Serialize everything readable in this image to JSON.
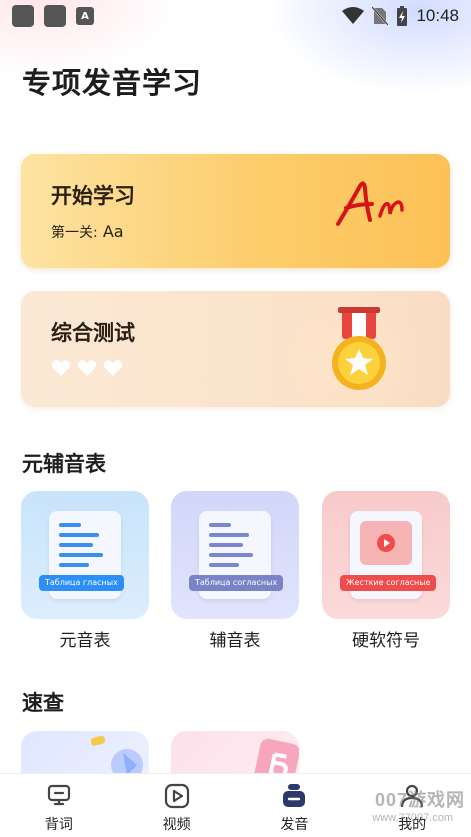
{
  "status_bar": {
    "time": "10:48",
    "notification_letter": "A"
  },
  "page": {
    "title": "专项发音学习"
  },
  "start_card": {
    "title": "开始学习",
    "level_prefix": "第一关:",
    "level_value": "Aa",
    "accent_color": "#fcc156"
  },
  "test_card": {
    "title": "综合测试",
    "hearts": 3
  },
  "phonetics_section": {
    "title": "元辅音表",
    "tiles": [
      {
        "label": "元音表",
        "badge": "Таблица гласных",
        "badge_color": "#2b8ff5"
      },
      {
        "label": "辅音表",
        "badge": "Таблица согласных",
        "badge_color": "#7b83c8"
      },
      {
        "label": "硬软符号",
        "badge": "Жесткие согласные",
        "badge_color": "#ef4c4c"
      }
    ]
  },
  "quick_section": {
    "title": "速查"
  },
  "tabbar": {
    "tabs": [
      {
        "label": "背词",
        "icon": "flashcard-icon",
        "active": false
      },
      {
        "label": "视频",
        "icon": "play-icon",
        "active": false
      },
      {
        "label": "发音",
        "icon": "pronunciation-icon",
        "active": true
      },
      {
        "label": "我的",
        "icon": "profile-icon",
        "active": false
      }
    ]
  },
  "watermark": {
    "text": "007游戏网",
    "url": "www.77007.com"
  }
}
